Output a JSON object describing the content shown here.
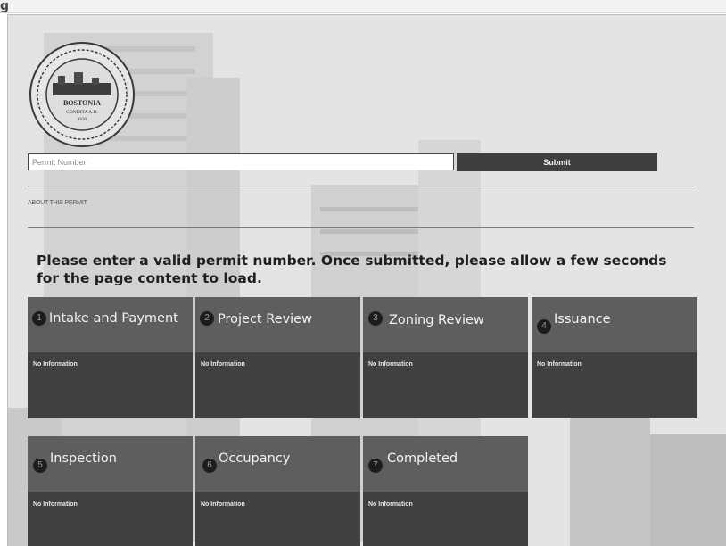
{
  "browser": {
    "glyph": "g"
  },
  "seal": {
    "text_line1": "BOSTONIA",
    "text_line2": "CONDITA A.D.",
    "text_line3": "1630"
  },
  "search": {
    "placeholder": "Permit Number",
    "value": "",
    "submit_label": "Submit"
  },
  "about_label": "ABOUT THIS PERMIT",
  "notice": "Please enter a valid permit number. Once submitted, please allow a few seconds for the page content to load.",
  "stages": [
    {
      "number": "1",
      "title": "Intake and Payment",
      "info": "No Information"
    },
    {
      "number": "2",
      "title": "Project Review",
      "info": "No Information"
    },
    {
      "number": "3",
      "title": "Zoning Review",
      "info": "No Information"
    },
    {
      "number": "4",
      "title": "Issuance",
      "info": "No Information"
    },
    {
      "number": "5",
      "title": "Inspection",
      "info": "No Information"
    },
    {
      "number": "6",
      "title": "Occupancy",
      "info": "No Information"
    },
    {
      "number": "7",
      "title": "Completed",
      "info": "No Information"
    }
  ],
  "colors": {
    "card_header": "#5e5e5e",
    "card_body": "#404040",
    "submit_button": "#3f3f3f",
    "notice_text": "#1f1f1f"
  }
}
